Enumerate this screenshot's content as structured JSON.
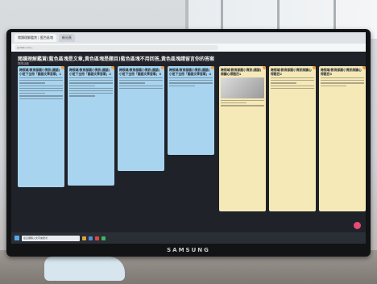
{
  "browser": {
    "tabs": [
      "閱讀理解鑑賞 | 藍色區塊",
      "新分頁"
    ],
    "url": "padlet.com/..."
  },
  "board": {
    "title": "閱讀理解鑑賞(藍色區塊是文章,黃色區塊是題目)藍色區塊不用回答,黃色區塊請留言你的答案",
    "subtitle": "閱讀活動"
  },
  "cards": [
    {
      "color": "blue",
      "head": "跨領域/教育部國小資訊(國語)小班下全冊「國語文學習單」1"
    },
    {
      "color": "blue",
      "head": "跨領域/教育部國小資訊(國語)小班下全冊「國語文學習單」2"
    },
    {
      "color": "blue",
      "head": "跨領域/教育部國小資訊(國語)小班下全冊「國語文學習單」3"
    },
    {
      "color": "blue",
      "head": "跨領域/教育部國小資訊(國語)小班下全冊「國語文學習單」4"
    },
    {
      "color": "yellow",
      "head": "跨領域/教育部國小資訊(國語)閱讀心得題目1"
    },
    {
      "color": "yellow",
      "head": "跨領域/教育部國小資訊閱讀心得題目2"
    },
    {
      "color": "yellow",
      "head": "跨領域/教育部國小資訊閱讀心得題目3"
    }
  ],
  "taskbar": {
    "search_placeholder": "在這裡輸入文字來搜尋"
  },
  "monitor": {
    "brand": "SAMSUNG"
  }
}
